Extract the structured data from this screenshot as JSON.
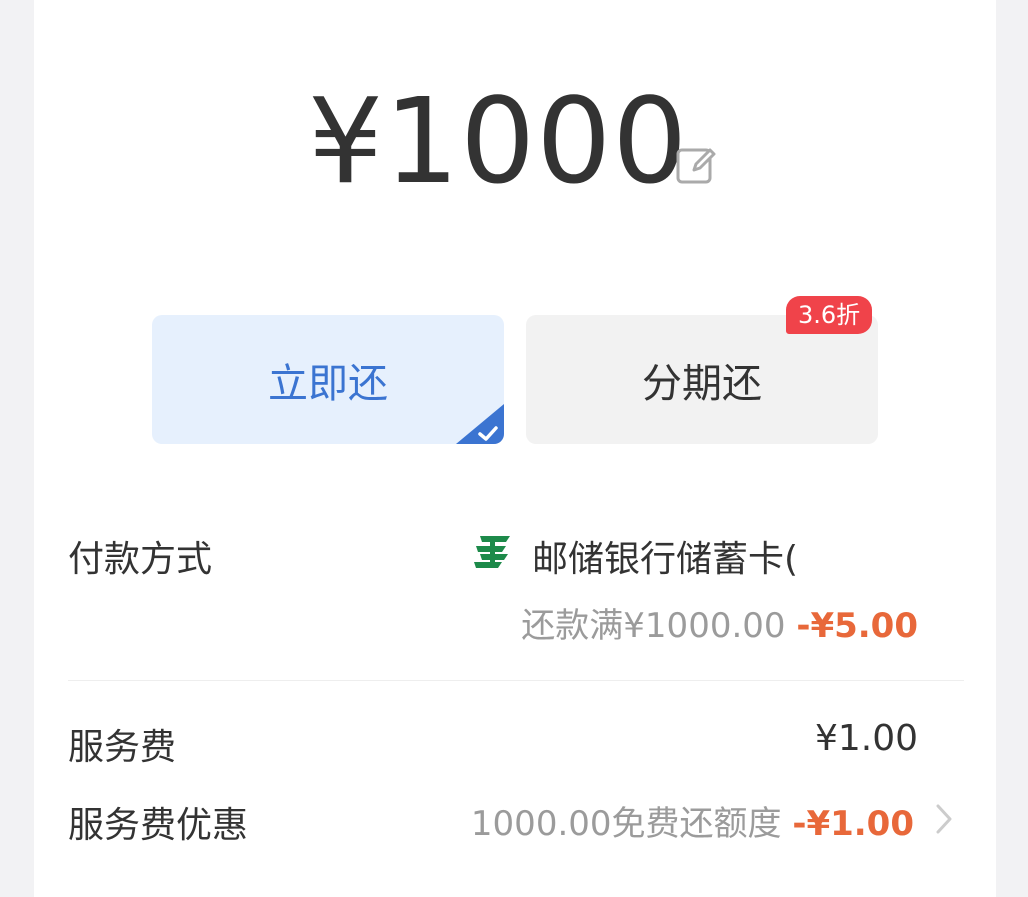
{
  "amount": {
    "display": "¥1000"
  },
  "options": {
    "pay_now_label": "立即还",
    "installment_label": "分期还",
    "installment_badge": "3.6折"
  },
  "payment_method": {
    "label": "付款方式",
    "bank_name": "邮储银行储蓄卡(",
    "promo_text": "还款满¥1000.00",
    "promo_discount": "-¥5.00"
  },
  "service_fee": {
    "label": "服务费",
    "value": "¥1.00"
  },
  "service_fee_discount": {
    "label": "服务费优惠",
    "text": "1000.00免费还额度",
    "discount": "-¥1.00"
  },
  "colors": {
    "accent_blue": "#3b74d1",
    "badge_red": "#f0434a",
    "discount_orange": "#e8683a",
    "bank_green": "#1d8a4a"
  },
  "icons": {
    "edit": "edit-icon",
    "check": "check-icon",
    "bank": "psbc-bank-logo-icon",
    "chevron": "chevron-right-icon"
  }
}
